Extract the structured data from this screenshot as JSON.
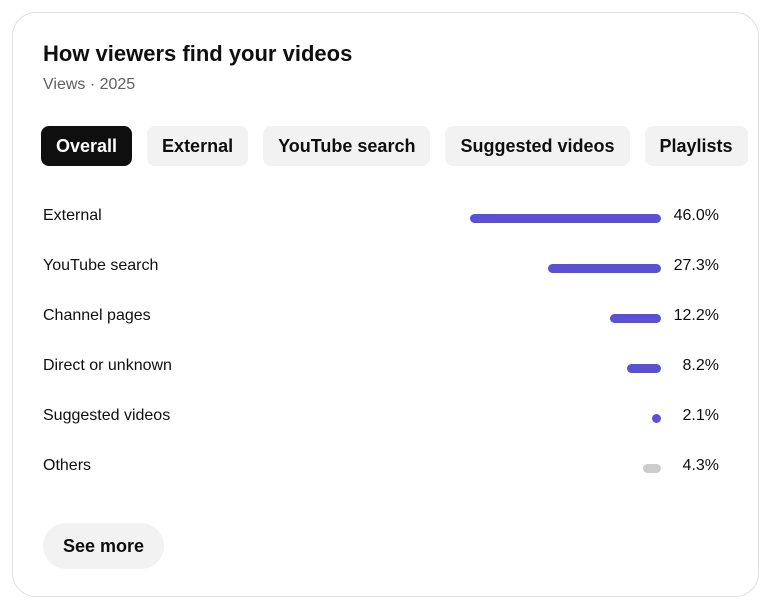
{
  "card": {
    "title": "How viewers find your videos",
    "subtitle": "Views · 2025"
  },
  "tabs": [
    {
      "label": "Overall",
      "active": true
    },
    {
      "label": "External",
      "active": false
    },
    {
      "label": "YouTube search",
      "active": false
    },
    {
      "label": "Suggested videos",
      "active": false
    },
    {
      "label": "Playlists",
      "active": false
    }
  ],
  "chart_data": {
    "type": "bar",
    "categories": [
      "External",
      "YouTube search",
      "Channel pages",
      "Direct or unknown",
      "Suggested videos",
      "Others"
    ],
    "values": [
      46.0,
      27.3,
      12.2,
      8.2,
      2.1,
      4.3
    ],
    "value_labels": [
      "46.0%",
      "27.3%",
      "12.2%",
      "8.2%",
      "2.1%",
      "4.3%"
    ],
    "colors": [
      "#5b4fd6",
      "#5b4fd6",
      "#5b4fd6",
      "#5b4fd6",
      "#5b4fd6",
      "#cccccc"
    ],
    "unit": "%"
  },
  "see_more_label": "See more",
  "colors": {
    "accent": "#5b4fd6",
    "others": "#cccccc",
    "chip_bg": "#f2f2f2",
    "chip_active_bg": "#0f0f0f"
  }
}
